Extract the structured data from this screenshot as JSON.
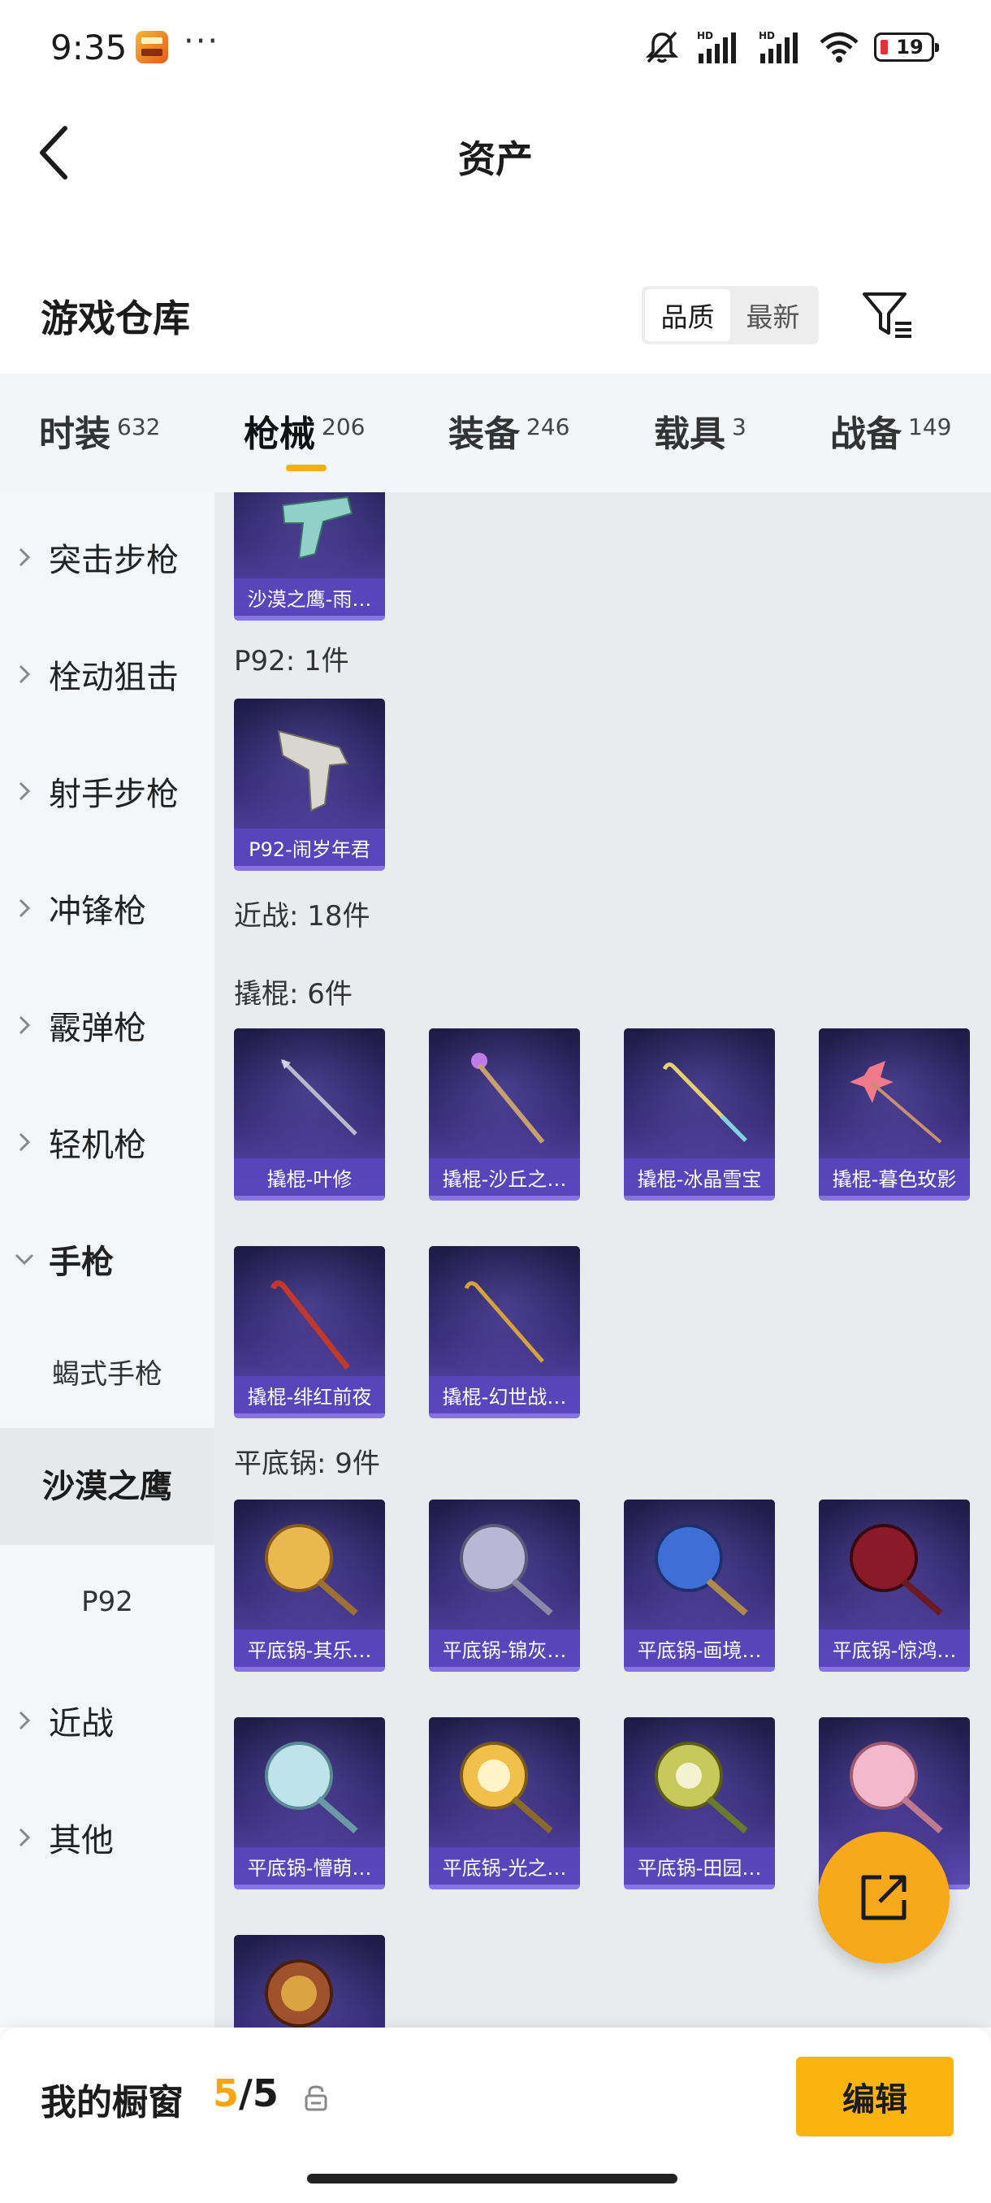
{
  "status_bar": {
    "time": "9:35",
    "dots": "···",
    "battery": "19",
    "signal_label_1": "HD",
    "signal_label_2": "HD"
  },
  "header": {
    "title": "资产"
  },
  "warehouse": {
    "title": "游戏仓库",
    "sort_options": [
      "品质",
      "最新"
    ],
    "sort_active": "品质"
  },
  "tabs": [
    {
      "label": "时装",
      "count": "632"
    },
    {
      "label": "枪械",
      "count": "206",
      "active": true
    },
    {
      "label": "装备",
      "count": "246"
    },
    {
      "label": "载具",
      "count": "3"
    },
    {
      "label": "战备",
      "count": "149"
    }
  ],
  "sidebar": {
    "items": [
      "突击步枪",
      "栓动狙击",
      "射手步枪",
      "冲锋枪",
      "霰弹枪",
      "轻机枪",
      "手枪",
      "蝎式手枪",
      "沙漠之鹰",
      "P92",
      "近战",
      "其他"
    ]
  },
  "content": {
    "top_card": "沙漠之鹰-雨…",
    "p92_label": "P92: 1件",
    "p92_card": "P92-闹岁年君",
    "melee_label": "近战: 18件",
    "crowbar_label": "撬棍: 6件",
    "crowbars": [
      "撬棍-叶修",
      "撬棍-沙丘之…",
      "撬棍-冰晶雪宝",
      "撬棍-暮色玫影",
      "撬棍-绯红前夜",
      "撬棍-幻世战…"
    ],
    "pan_label": "平底锅: 9件",
    "pans": [
      "平底锅-其乐…",
      "平底锅-锦灰…",
      "平底锅-画境…",
      "平底锅-惊鸿…",
      "平底锅-懵萌…",
      "平底锅-光之…",
      "平底锅-田园…"
    ]
  },
  "bottom": {
    "window_label": "我的橱窗",
    "count_current": "5",
    "count_sep": "/",
    "count_total": "5",
    "edit_label": "编辑"
  },
  "colors": {
    "accent": "#f6b012",
    "card_bg": "#2e2766",
    "card_caption": "#5a46be"
  }
}
